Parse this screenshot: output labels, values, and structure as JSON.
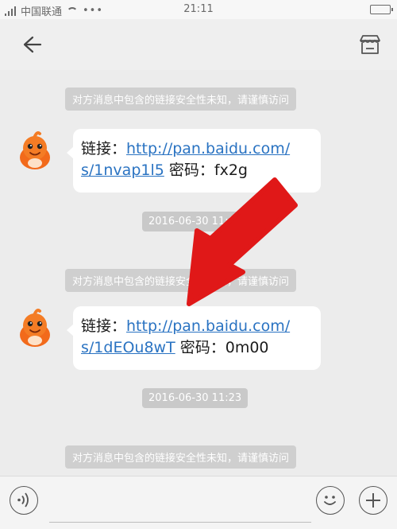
{
  "status_bar": {
    "carrier": "中国联通",
    "time": "21:11",
    "icons": [
      "signal-icon",
      "wifi-icon",
      "battery-icon"
    ]
  },
  "nav": {
    "back_icon": "back-arrow-icon",
    "store_icon": "store-icon"
  },
  "messages": {
    "notice_text": "对方消息中包含的链接安全性未知，请谨慎访问",
    "msg1": {
      "label": "链接：",
      "link": "http://pan.baidu.com/s/1nvap1l5",
      "link_line1": "http://pan.baidu.com/",
      "link_line2": "s/1nvap1l5",
      "pwd_label": "密码：",
      "pwd": "fx2g"
    },
    "ts1": "2016-06-30 11:08",
    "msg2": {
      "label": "链接：",
      "link": "http://pan.baidu.com/s/1dEOu8wT",
      "link_line1": "http://pan.baidu.com/",
      "link_line2": "s/1dEOu8wT",
      "pwd_label": "密码：",
      "pwd": "0m00"
    },
    "ts2": "2016-06-30 11:23"
  },
  "input_bar": {
    "voice_icon": "voice-icon",
    "emoji_icon": "emoji-icon",
    "plus_icon": "plus-icon",
    "input_value": ""
  },
  "colors": {
    "link": "#2a73c2",
    "annotation_arrow": "#e01818",
    "background": "#ececec"
  }
}
